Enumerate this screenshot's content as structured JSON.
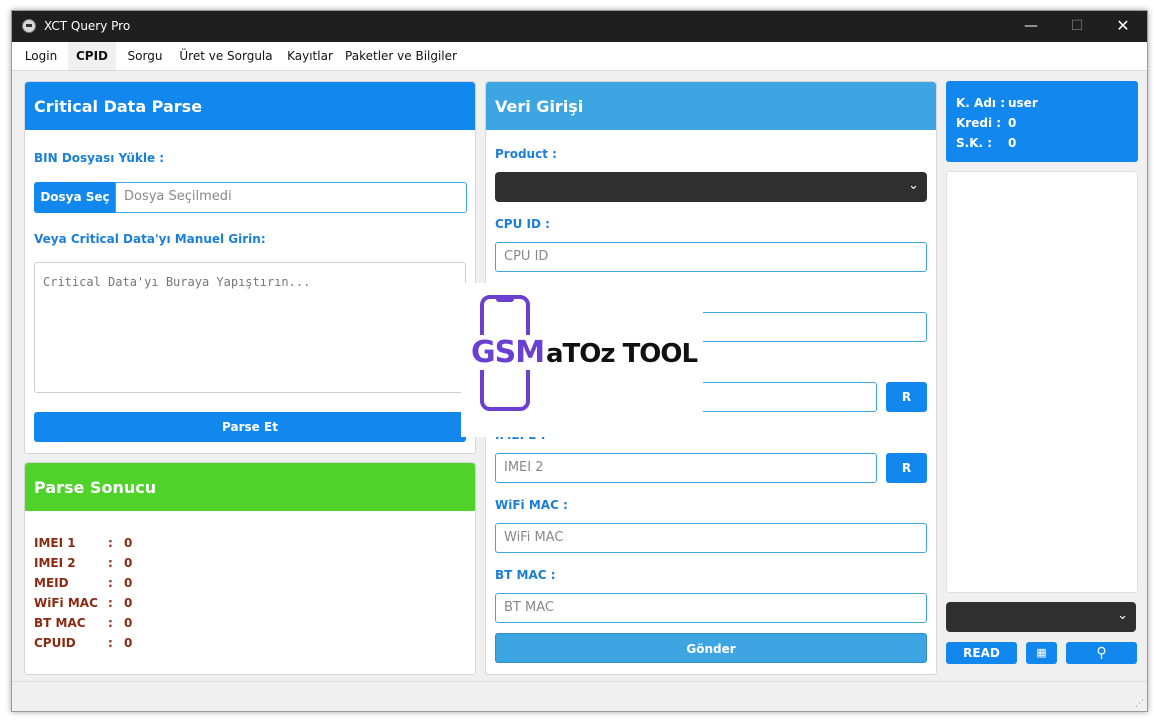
{
  "window": {
    "title": "XCT Query Pro",
    "min": "—",
    "max": "☐",
    "close": "✕"
  },
  "menu": [
    "Login",
    "CPID",
    "Sorgu",
    "Üret ve Sorgula",
    "Kayıtlar",
    "Paketler ve Bilgiler"
  ],
  "critical": {
    "title": "Critical Data Parse",
    "bin_label": "BIN Dosyası Yükle :",
    "choose_btn": "Dosya Seç",
    "file_placeholder": "Dosya Seçilmedi",
    "manual_label": "Veya Critical Data'yı Manuel Girin:",
    "textarea_placeholder": "Critical Data'yı Buraya Yapıştırın...",
    "parse_btn": "Parse Et"
  },
  "result": {
    "title": "Parse Sonucu",
    "rows": [
      {
        "k": "IMEI 1",
        "v": "0"
      },
      {
        "k": "IMEI 2",
        "v": "0"
      },
      {
        "k": "MEID",
        "v": "0"
      },
      {
        "k": "WiFi MAC",
        "v": "0"
      },
      {
        "k": "BT MAC",
        "v": "0"
      },
      {
        "k": "CPUID",
        "v": "0"
      }
    ]
  },
  "entry": {
    "title": "Veri Girişi",
    "product_label": "Product :",
    "cpu_label": "CPU ID :",
    "cpu_placeholder": "CPU ID",
    "imei2_label": "IMEI 2 :",
    "imei2_placeholder": "IMEI 2",
    "wifi_label": "WiFi MAC :",
    "wifi_placeholder": "WiFi MAC",
    "bt_label": "BT MAC :",
    "bt_placeholder": "BT MAC",
    "r_btn": "R",
    "send_btn": "Gönder"
  },
  "info": {
    "user_label": "K. Adı :",
    "user_value": "user",
    "credit_label": "Kredi :",
    "credit_value": "0",
    "sk_label": "S.K. :",
    "sk_value": "0"
  },
  "right_buttons": {
    "read": "READ"
  },
  "watermark": {
    "gsm": "GSM",
    "rest": "aTOz TOOL"
  },
  "colors": {
    "primary": "#1287ee",
    "light_blue": "#3ea5e3",
    "green": "#4fd22a",
    "result_text": "#8b2a12"
  }
}
